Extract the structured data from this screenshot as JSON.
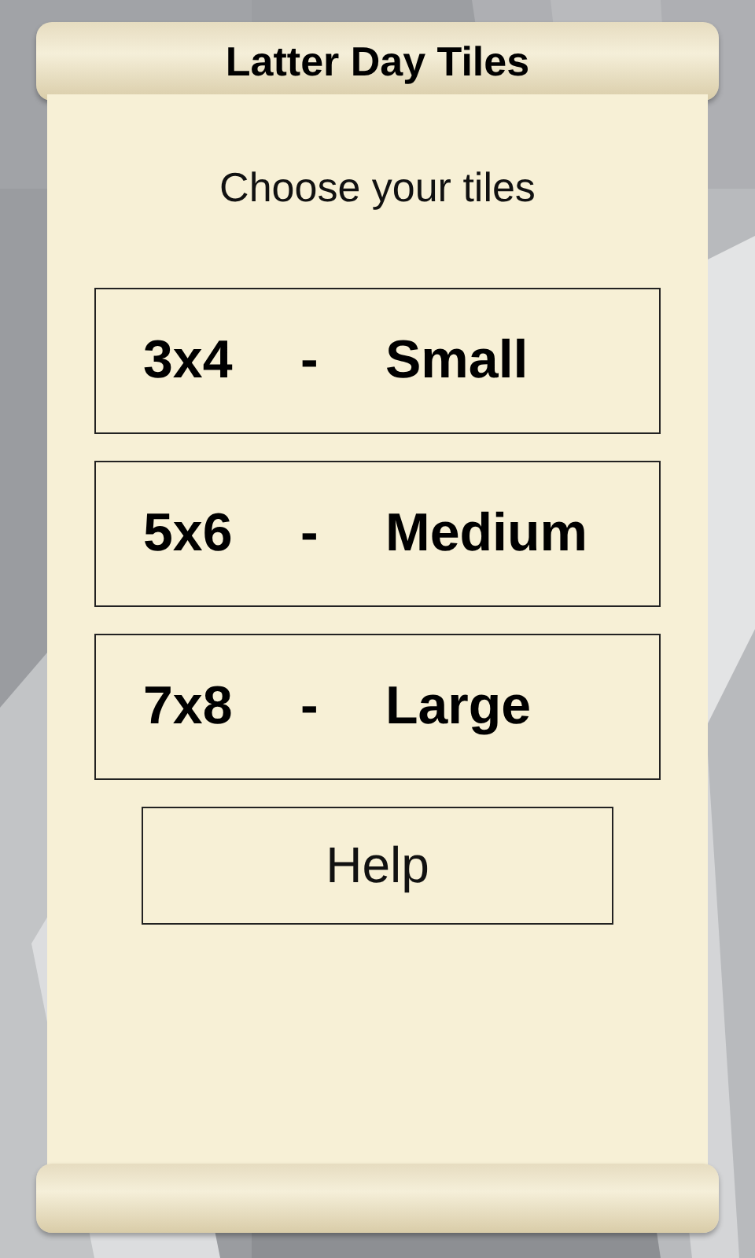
{
  "title": "Latter Day Tiles",
  "prompt": "Choose your tiles",
  "options": [
    {
      "size": "3x4",
      "separator": "-",
      "name": "Small"
    },
    {
      "size": "5x6",
      "separator": "-",
      "name": "Medium"
    },
    {
      "size": "7x8",
      "separator": "-",
      "name": "Large"
    }
  ],
  "help_button": "Help"
}
